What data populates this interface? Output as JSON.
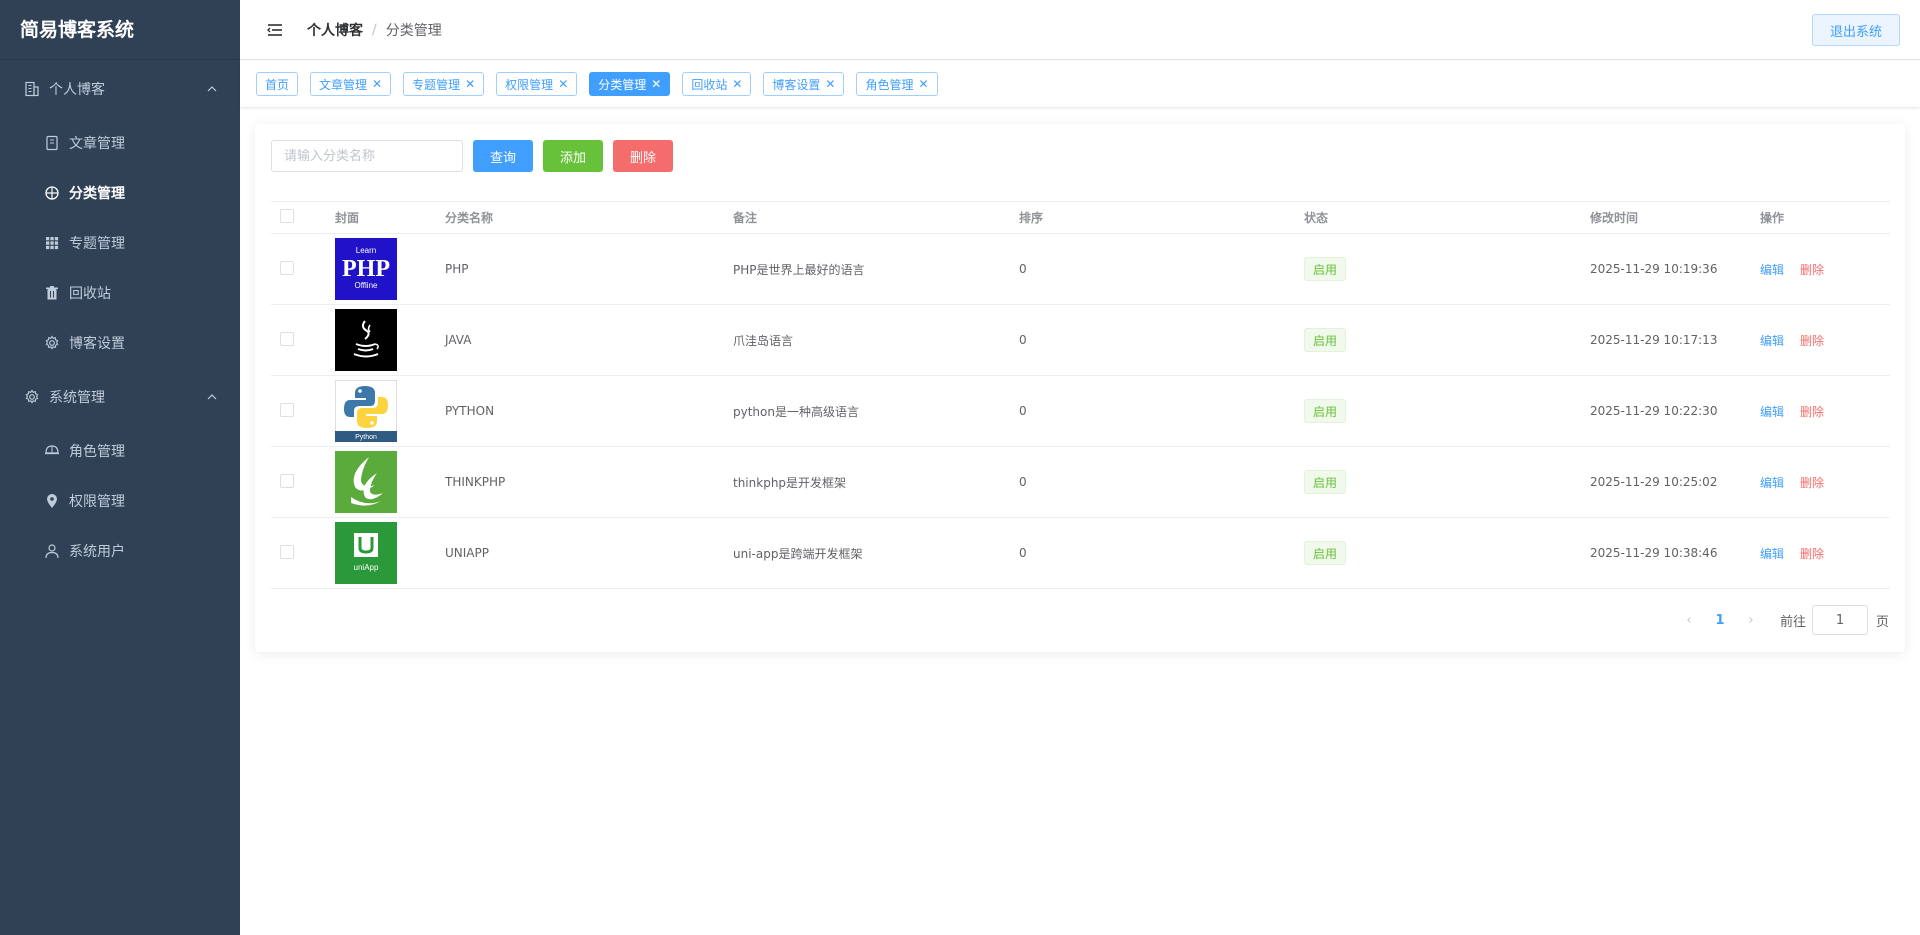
{
  "app": {
    "title": "简易博客系统"
  },
  "sidebar": {
    "groups": [
      {
        "label": "个人博客",
        "icon": "building-icon",
        "items": [
          {
            "label": "文章管理",
            "icon": "book-icon"
          },
          {
            "label": "分类管理",
            "icon": "category-icon",
            "active": true
          },
          {
            "label": "专题管理",
            "icon": "grid-icon"
          },
          {
            "label": "回收站",
            "icon": "trash-icon"
          },
          {
            "label": "博客设置",
            "icon": "gear-icon"
          }
        ]
      },
      {
        "label": "系统管理",
        "icon": "gear-icon",
        "items": [
          {
            "label": "角色管理",
            "icon": "helmet-icon"
          },
          {
            "label": "权限管理",
            "icon": "location-icon"
          },
          {
            "label": "系统用户",
            "icon": "user-icon"
          }
        ]
      }
    ]
  },
  "header": {
    "breadcrumb": [
      "个人博客",
      "分类管理"
    ],
    "breadcrumb_sep": "/",
    "logout_label": "退出系统"
  },
  "tags": [
    {
      "label": "首页",
      "closable": false,
      "active": false
    },
    {
      "label": "文章管理",
      "closable": true,
      "active": false
    },
    {
      "label": "专题管理",
      "closable": true,
      "active": false
    },
    {
      "label": "权限管理",
      "closable": true,
      "active": false
    },
    {
      "label": "分类管理",
      "closable": true,
      "active": true
    },
    {
      "label": "回收站",
      "closable": true,
      "active": false
    },
    {
      "label": "博客设置",
      "closable": true,
      "active": false
    },
    {
      "label": "角色管理",
      "closable": true,
      "active": false
    }
  ],
  "toolbar": {
    "search_placeholder": "请输入分类名称",
    "query_label": "查询",
    "add_label": "添加",
    "delete_label": "删除"
  },
  "table": {
    "columns": [
      "封面",
      "分类名称",
      "备注",
      "排序",
      "状态",
      "修改时间",
      "操作"
    ],
    "rows": [
      {
        "cover": "php-logo",
        "name": "PHP",
        "note": "PHP是世界上最好的语言",
        "sort": "0",
        "status": "启用",
        "time": "2025-11-29 10:19:36"
      },
      {
        "cover": "java-logo",
        "name": "JAVA",
        "note": "爪洼岛语言",
        "sort": "0",
        "status": "启用",
        "time": "2025-11-29 10:17:13"
      },
      {
        "cover": "python-logo",
        "name": "PYTHON",
        "note": "python是一种高级语言",
        "sort": "0",
        "status": "启用",
        "time": "2025-11-29 10:22:30"
      },
      {
        "cover": "thinkphp-logo",
        "name": "THINKPHP",
        "note": "thinkphp是开发框架",
        "sort": "0",
        "status": "启用",
        "time": "2025-11-29 10:25:02"
      },
      {
        "cover": "uniapp-logo",
        "name": "UNIAPP",
        "note": "uni-app是跨端开发框架",
        "sort": "0",
        "status": "启用",
        "time": "2025-11-29 10:38:46"
      }
    ],
    "edit_label": "编辑",
    "delete_label": "删除"
  },
  "pagination": {
    "current_page": "1",
    "goto_label": "前往",
    "goto_value": "1",
    "unit_label": "页"
  },
  "colors": {
    "sidebar_bg": "#304156",
    "primary": "#409eff",
    "success": "#67c23a",
    "danger": "#f56c6c"
  }
}
